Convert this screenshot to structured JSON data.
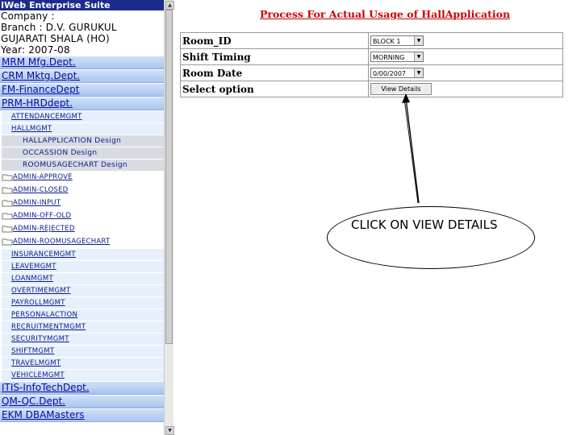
{
  "sidebar": {
    "suite_title": "IWeb Enterprise Suite",
    "company": "Company :",
    "branch": "Branch : D.V. GURUKUL",
    "branch_line2": "GUJARATI SHALA (HO)",
    "year": "Year: 2007-08",
    "depts_top": [
      "MRM Mfg.Dept.",
      "CRM Mktg.Dept.",
      "FM-FinanceDept",
      "PRM-HRDdept."
    ],
    "modules_a": [
      "ATTENDANCEMGMT",
      "HALLMGMT"
    ],
    "designs": [
      "HALLAPPLICATION Design",
      "OCCASSION Design",
      "ROOMUSAGECHART Design"
    ],
    "admin_items": [
      "ADMIN-APPROVE",
      "ADMIN-CLOSED",
      "ADMIN-INPUT",
      "ADMIN-OFF-OLD",
      "ADMIN-REJECTED",
      "ADMIN-ROOMUSAGECHART"
    ],
    "modules_b": [
      "INSURANCEMGMT",
      "LEAVEMGMT",
      "LOANMGMT",
      "OVERTIMEMGMT",
      "PAYROLLMGMT",
      "PERSONALACTION",
      "RECRUITMENTMGMT",
      "SECURITYMGMT",
      "SHIFTMGMT",
      "TRAVELMGMT",
      "VEHICLEMGMT"
    ],
    "depts_bottom": [
      "ITIS-InfoTechDept.",
      "QM-QC.Dept.",
      "EKM DBAMasters"
    ]
  },
  "main": {
    "title": "Process For Actual Usage of HallApplication",
    "fields": {
      "room_id": {
        "label": "Room_ID",
        "value": "BLOCK 1"
      },
      "shift": {
        "label": "Shift Timing",
        "value": "MORNING"
      },
      "date": {
        "label": "Room Date",
        "value": "0/00/2007"
      },
      "option": {
        "label": "Select option",
        "button": "View Details"
      }
    }
  },
  "annotation": {
    "text": "CLICK ON VIEW DETAILS"
  },
  "colors": {
    "title_red": "#cc0000",
    "suite_bar": "#1c2c8c",
    "dept_link": "#0a0aa0",
    "module_link": "#0a1a8a"
  }
}
